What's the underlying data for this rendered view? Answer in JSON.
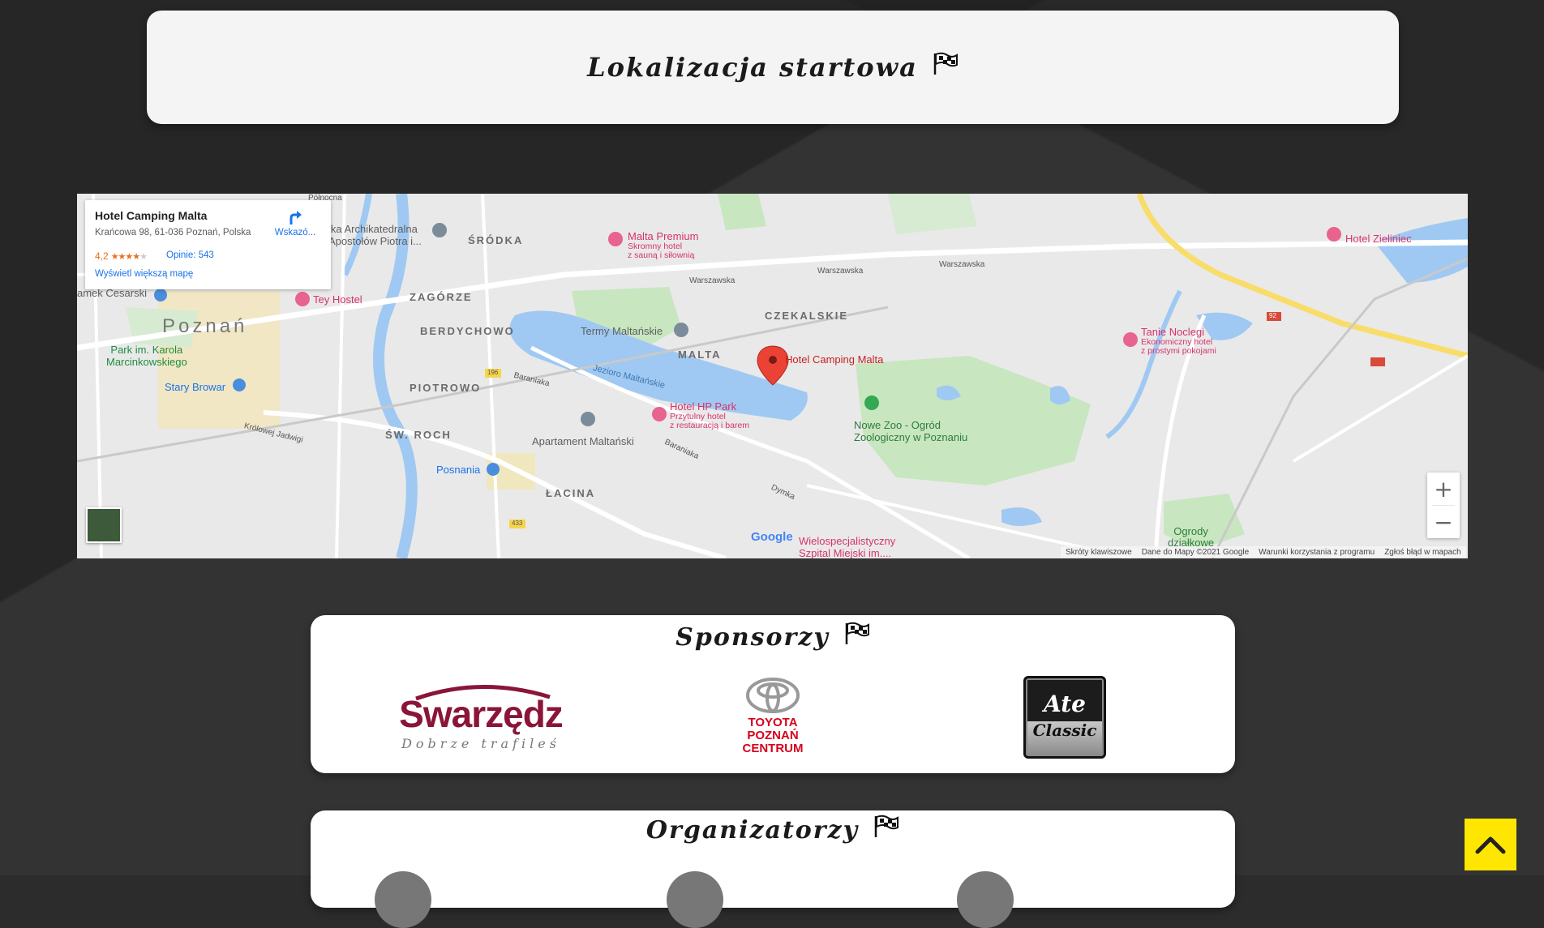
{
  "location_section": {
    "title": "Lokalizacja startowa"
  },
  "map": {
    "info_card": {
      "title": "Hotel Camping Malta",
      "address": "Krańcowa 98, 61-036 Poznań, Polska",
      "rating": "4,2",
      "stars": "★★★★",
      "star_empty": "★",
      "reviews": "Opinie: 543",
      "larger_map": "Wyświetl większą mapę",
      "directions": "Wskazó..."
    },
    "labels": {
      "poznan": "Poznań",
      "srodka": "ŚRÓDKA",
      "zagorze": "ZAGÓRZE",
      "berdychowo": "BERDYCHOWO",
      "piotrowo": "PIOTROWO",
      "sw_roch": "ŚW. ROCH",
      "lacina": "ŁACINA",
      "malta": "MALTA",
      "czekalskie": "CZEKALSKIE",
      "park": "Park im. Karola",
      "park2": "Marcinkowskiego",
      "stary_browar": "Stary Browar",
      "posnania": "Posnania",
      "termy": "Termy Maltańskie",
      "apartament": "Apartament Maltański",
      "jezioro": "Jezioro Maltańskie",
      "archikatedra": "ika Archikatedralna",
      "archikatedra2": "Apostołów Piotra i...",
      "zamek": "amek Cesarski",
      "nowe_zoo": "Nowe Zoo - Ogród",
      "nowe_zoo2": "Zoologiczny w Poznaniu",
      "ogrody": "Ogrody",
      "ogrody2": "działkowe",
      "szpital": "Wielospecjalistyczny",
      "szpital2": "Szpital Miejski im....",
      "warszawska": "Warszawska",
      "baraniaka": "Baraniaka",
      "dymka": "Dymka",
      "krolowej": "Królowej Jadwigi",
      "polnocna": "Północna",
      "rd196": "196",
      "rd433": "433",
      "rd92": "92"
    },
    "pois": {
      "malta_premium": "Malta Premium",
      "malta_premium_sub1": "Skromny hotel",
      "malta_premium_sub2": "z sauną i siłownią",
      "tey_hostel": "Tey Hostel",
      "hotel_hp": "Hotel HP Park",
      "hotel_hp_sub1": "Przytulny hotel",
      "hotel_hp_sub2": "z restauracją i barem",
      "tanie_noclegi": "Tanie Noclegi",
      "tanie_noclegi_sub1": "Ekonomiczny hotel",
      "tanie_noclegi_sub2": "z prostymi pokojami",
      "hotel_zieliniec": "Hotel Zieliniec",
      "hotel_camping": "Hotel Camping Malta"
    },
    "zoom_in": "+",
    "zoom_out": "−",
    "google": "Google",
    "attribution": {
      "shortcuts": "Skróty klawiszowe",
      "data": "Dane do Mapy ©2021 Google",
      "terms": "Warunki korzystania z programu",
      "report": "Zgłoś błąd w mapach"
    }
  },
  "sponsors_section": {
    "title": "Sponsorzy",
    "swarzedz": "Swarzędz",
    "swarzedz_sub": "Dobrze trafileś",
    "toyota_line1": "TOYOTA",
    "toyota_line2": "POZNAŃ",
    "toyota_line3": "CENTRUM",
    "ate_top": "Ate",
    "ate_bottom": "Classic"
  },
  "organizers_section": {
    "title": "Organizatorzy"
  },
  "colors": {
    "accent_yellow": "#ffe600",
    "poi_pink": "#d6336c",
    "link_blue": "#1a73e8",
    "swarzedz_maroon": "#8a1538",
    "toyota_red": "#d6001c"
  }
}
